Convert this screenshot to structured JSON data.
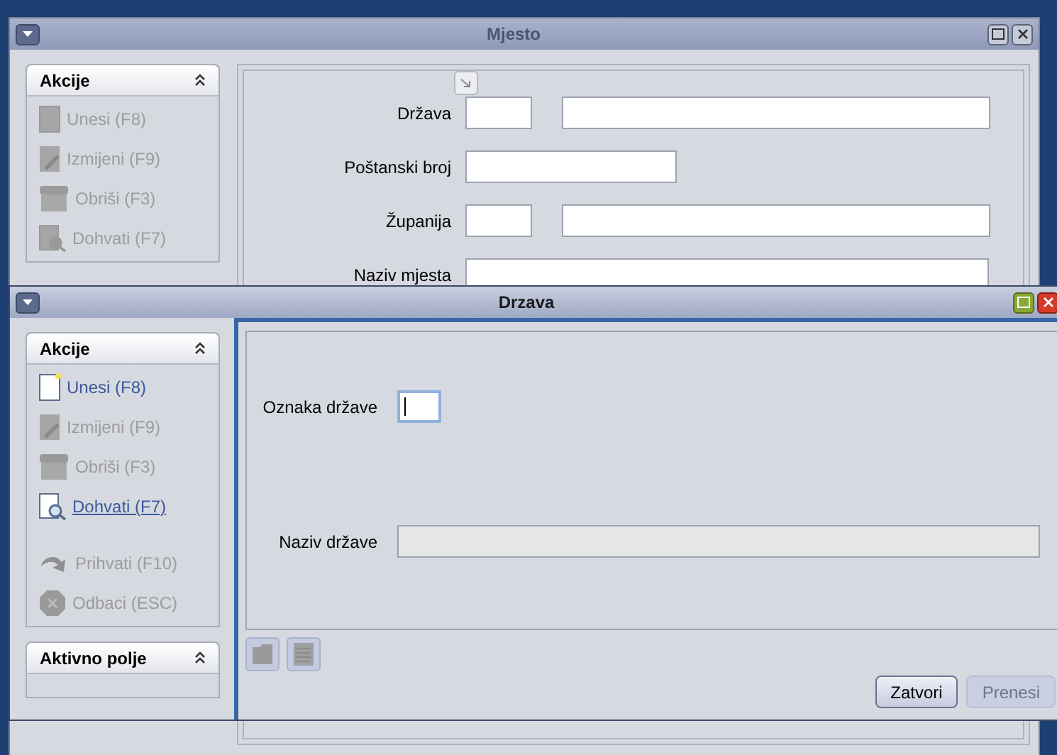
{
  "back_window": {
    "title": "Mjesto",
    "active": false,
    "sidebar": [
      {
        "title": "Akcije",
        "groups": [
          [
            {
              "label": "Unesi (F8)",
              "enabled": false,
              "focused": false
            },
            {
              "label": "Izmijeni (F9)",
              "enabled": false,
              "focused": false
            },
            {
              "label": "Obriši (F3)",
              "enabled": false,
              "focused": false
            },
            {
              "label": "Dohvati (F7)",
              "enabled": false,
              "focused": false
            }
          ]
        ]
      }
    ],
    "fields": [
      {
        "label": "Država",
        "kind": "pair"
      },
      {
        "label": "Poštanski broj",
        "kind": "medium"
      },
      {
        "label": "Županija",
        "kind": "pair"
      },
      {
        "label": "Naziv mjesta",
        "kind": "long"
      }
    ]
  },
  "front_window": {
    "title": "Drzava",
    "active": true,
    "sidebar": [
      {
        "title": "Akcije",
        "groups": [
          [
            {
              "label": "Unesi (F8)",
              "enabled": true,
              "focused": false
            },
            {
              "label": "Izmijeni (F9)",
              "enabled": false,
              "focused": false
            },
            {
              "label": "Obriši (F3)",
              "enabled": false,
              "focused": false
            },
            {
              "label": "Dohvati (F7)",
              "enabled": true,
              "focused": true
            }
          ],
          [
            {
              "label": "Prihvati (F10)",
              "enabled": false,
              "focused": false
            },
            {
              "label": "Odbaci (ESC)",
              "enabled": false,
              "focused": false
            }
          ]
        ]
      },
      {
        "title": "Aktivno polje"
      }
    ],
    "fields": [
      {
        "label": "Oznaka države",
        "kind": "short",
        "focused": true,
        "disabled": false
      },
      {
        "label": "Naziv države",
        "kind": "long",
        "focused": false,
        "disabled": true
      }
    ],
    "buttons": [
      {
        "label": "Zatvori",
        "disabled": false
      },
      {
        "label": "Prenesi",
        "disabled": true
      }
    ]
  }
}
